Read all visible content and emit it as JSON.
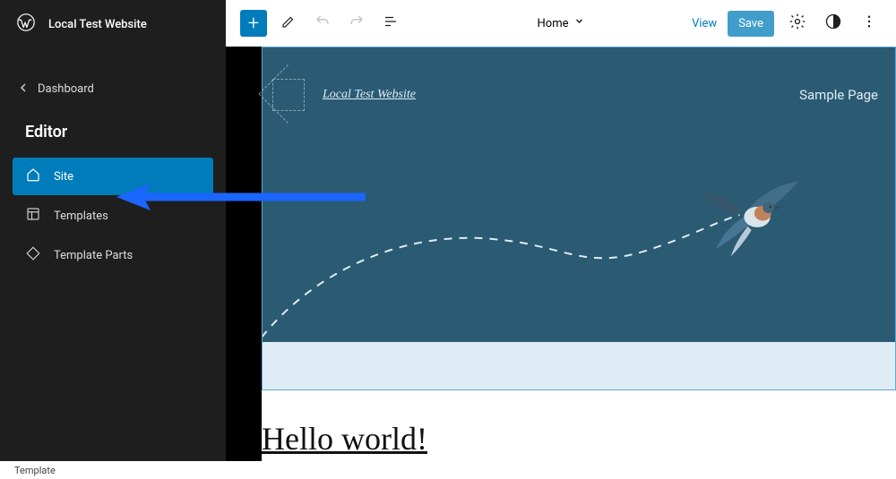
{
  "sidebar": {
    "site_title": "Local Test Website",
    "back_label": "Dashboard",
    "section_title": "Editor",
    "items": [
      {
        "label": "Site",
        "icon": "home-icon",
        "active": true
      },
      {
        "label": "Templates",
        "icon": "layout-icon",
        "active": false
      },
      {
        "label": "Template Parts",
        "icon": "diamond-icon",
        "active": false
      }
    ]
  },
  "topbar": {
    "template_label": "Home",
    "view_label": "View",
    "save_label": "Save"
  },
  "hero": {
    "site_link": "Local Test Website",
    "nav_link": "Sample Page"
  },
  "content": {
    "heading": "Hello world!"
  },
  "footer": {
    "breadcrumb": "Template"
  },
  "colors": {
    "accent": "#007cba",
    "sidebar_bg": "#1e1e1e",
    "hero_bg": "#0d3b4f"
  }
}
